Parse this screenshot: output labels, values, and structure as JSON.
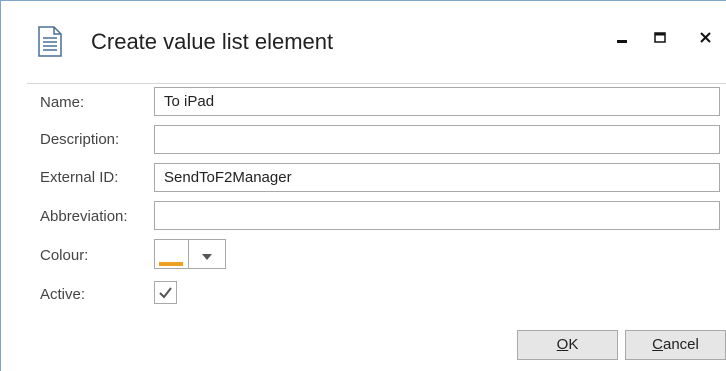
{
  "window": {
    "title": "Create value list element",
    "icons": {
      "app": "document-icon",
      "minimize": "minimize-icon",
      "maximize": "maximize-icon",
      "close": "close-icon"
    }
  },
  "form": {
    "name": {
      "label": "Name:",
      "value": "To iPad"
    },
    "description": {
      "label": "Description:",
      "value": ""
    },
    "external_id": {
      "label": "External ID:",
      "value": "SendToF2Manager"
    },
    "abbreviation": {
      "label": "Abbreviation:",
      "value": ""
    },
    "colour": {
      "label": "Colour:",
      "swatch_color": "#f0a020"
    },
    "active": {
      "label": "Active:",
      "checked": true
    }
  },
  "buttons": {
    "ok": {
      "accel": "O",
      "rest": "K"
    },
    "cancel": {
      "accel": "C",
      "rest": "ancel"
    }
  },
  "colors": {
    "border": "#a9a9a9",
    "button_face": "#e6e6e6",
    "window_edge": "#7fa6c9"
  }
}
